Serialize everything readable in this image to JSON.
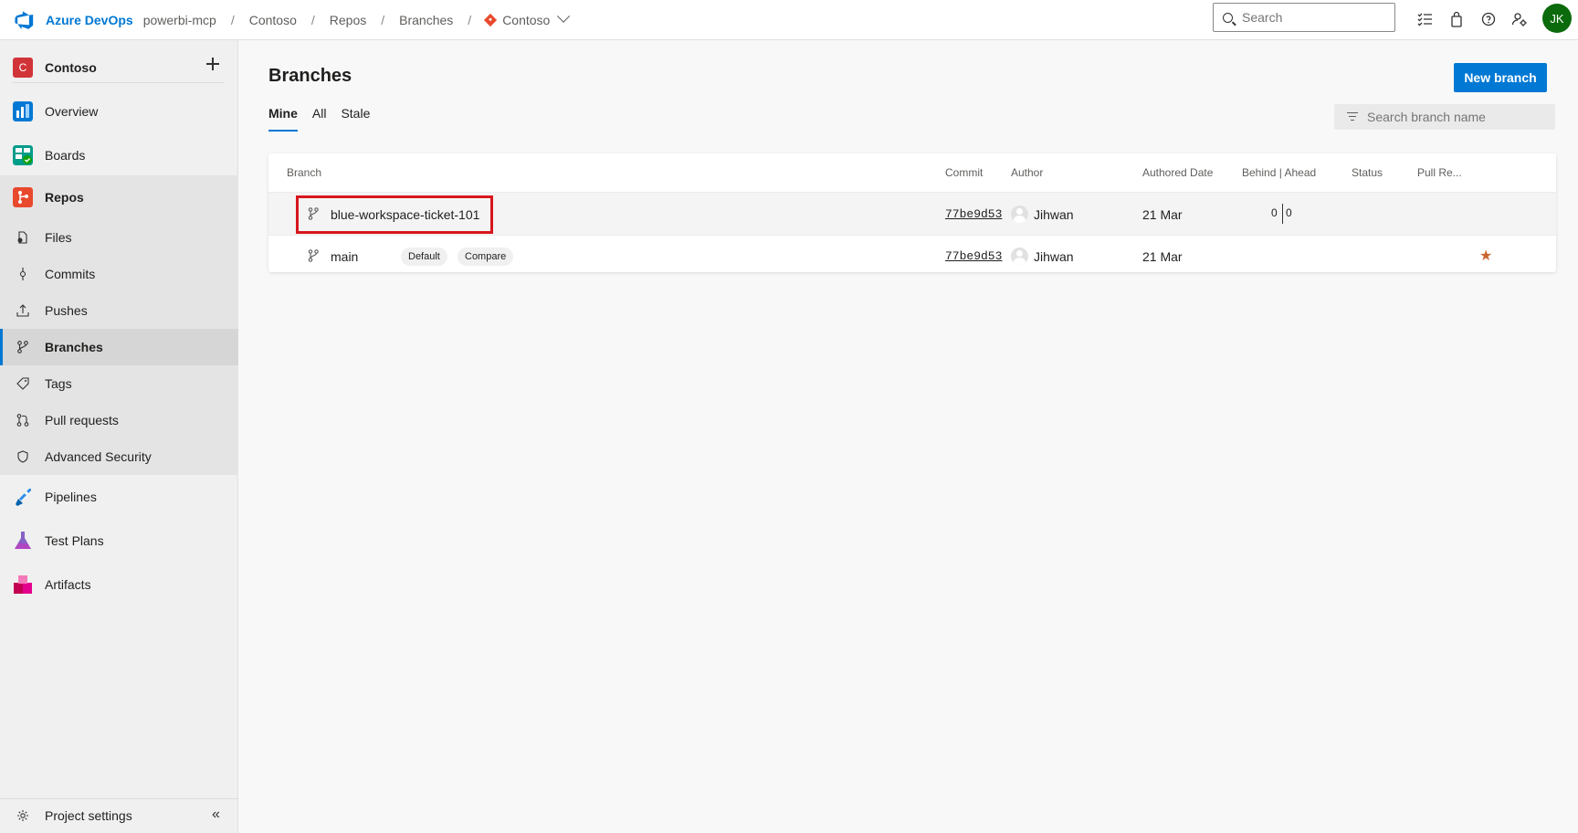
{
  "topbar": {
    "brand": "Azure DevOps",
    "breadcrumbs": [
      "powerbi-mcp",
      "Contoso",
      "Repos",
      "Branches",
      "Contoso"
    ],
    "search_placeholder": "Search",
    "avatar_initials": "JK"
  },
  "sidebar": {
    "project_initial": "C",
    "project_name": "Contoso",
    "items": {
      "overview": "Overview",
      "boards": "Boards",
      "repos": "Repos",
      "files": "Files",
      "commits": "Commits",
      "pushes": "Pushes",
      "branches": "Branches",
      "tags": "Tags",
      "pull_requests": "Pull requests",
      "advanced_security": "Advanced Security",
      "pipelines": "Pipelines",
      "test_plans": "Test Plans",
      "artifacts": "Artifacts",
      "project_settings": "Project settings"
    }
  },
  "main": {
    "title": "Branches",
    "new_branch_label": "New branch",
    "tabs": [
      "Mine",
      "All",
      "Stale"
    ],
    "active_tab": "Mine",
    "filter_placeholder": "Search branch name",
    "columns": {
      "branch": "Branch",
      "commit": "Commit",
      "author": "Author",
      "date": "Authored Date",
      "behind_ahead": "Behind | Ahead",
      "status": "Status",
      "pull_requests": "Pull Re..."
    },
    "rows": [
      {
        "name": "blue-workspace-ticket-101",
        "commit": "77be9d53",
        "author": "Jihwan",
        "date": "21 Mar",
        "behind": "0",
        "ahead": "0"
      },
      {
        "name": "main",
        "badge_default": "Default",
        "badge_compare": "Compare",
        "commit": "77be9d53",
        "author": "Jihwan",
        "date": "21 Mar"
      }
    ]
  },
  "colors": {
    "accent": "#0078d4",
    "highlight": "#d8161d",
    "star": "#c8652f",
    "avatar": "#0b6a0b"
  }
}
